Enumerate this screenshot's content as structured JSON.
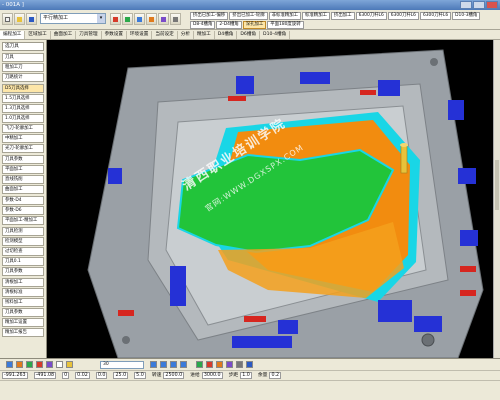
{
  "window": {
    "title": "- 001A ]"
  },
  "toolbar": {
    "mode_combo": "平行精加工",
    "operations_row1": [
      "挤出已加工-偏移",
      "挤出已加工-轮廓",
      "非标准精加工",
      "标准精加工",
      "挤出加工",
      "6300刀杆L6",
      "6300刀杆L6",
      "6300刀杆L6",
      "6300刀杆L6",
      "6300刀杆L6"
    ],
    "operations_row2": [
      "D10-3槽角",
      "D8-4槽角",
      "2-D4槽角",
      "深孔加工",
      "平面180度旋转"
    ],
    "active_operation": "深孔加工"
  },
  "tabs": [
    "编程加工",
    "区域加工",
    "曲面加工",
    "刀具管理",
    "参数设置",
    "环境设置",
    "当前设定",
    "分析",
    "精加工",
    "D4槽角",
    "D6槽角",
    "D10-4槽角"
  ],
  "left_panel": {
    "header": "选刀具",
    "groups": [
      {
        "label": "刀具",
        "items": [
          "粗加工刀",
          "刀路统计"
        ]
      },
      {
        "label": "",
        "items": [
          "D5刀具选择",
          "1.5刀具选择",
          "1.3刀具选择",
          "1.0刀具选择",
          "飞刀-轮廓加工",
          "中精加工",
          "光刀-轮廓加工"
        ]
      },
      {
        "label": "",
        "items": [
          "刀具参数",
          "平面加工",
          "直线铣削",
          "曲面加工"
        ]
      },
      {
        "label": "",
        "items": [
          "参数-D4",
          "参数-D6",
          "平面加工-精加工"
        ]
      },
      {
        "label": "",
        "items": [
          "刀具检测",
          "检测模型",
          "过切检查",
          "刀具0.1",
          "刀具参数"
        ]
      },
      {
        "label": "",
        "items": [
          "清根加工",
          "清根标准",
          "残料加工",
          "刀具参数",
          "精加工设置",
          "精加工报告"
        ]
      }
    ]
  },
  "viewport": {
    "watermark_main": "清西职业培训学院",
    "watermark_url": "官网:WWW.DGXSPX.COM",
    "colors": {
      "mold_base": "#9aa0a6",
      "cavity_floor": "#c9ced1",
      "green_surface": "#22c43a",
      "orange_surface": "#f28c0f",
      "cyan_edge": "#19d6e6",
      "blue_clamps": "#2531d6",
      "red_marks": "#d6261f",
      "yellow_pin": "#e8c23a"
    }
  },
  "status": {
    "coords": "-991.263",
    "coord2": "-491.08",
    "coord3": "0",
    "view_combo": "30",
    "tolerance": "0.02",
    "stepover": "0.0",
    "angle": "25.0",
    "depth": "5.0",
    "speed_label": "转速",
    "speed_value": "2500.0",
    "feed_label": "进给",
    "feed_value": "3000.0",
    "cut_label": "步距",
    "cut_value": "1.0",
    "stock_label": "余量",
    "stock_value": "0.2"
  }
}
